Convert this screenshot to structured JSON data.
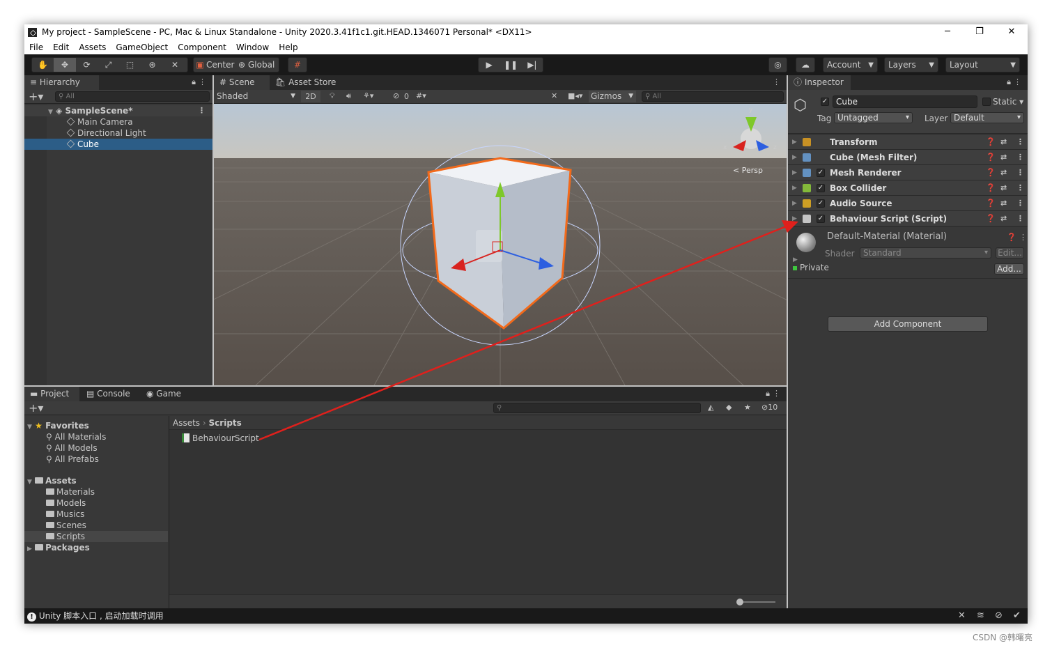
{
  "title_bar": {
    "title": "My project - SampleScene - PC, Mac & Linux Standalone - Unity 2020.3.41f1c1.git.HEAD.1346071 Personal* <DX11>",
    "minimize": "─",
    "restore": "❐",
    "close": "✕"
  },
  "menu": [
    "File",
    "Edit",
    "Assets",
    "GameObject",
    "Component",
    "Window",
    "Help"
  ],
  "toolbar": {
    "center": "Center",
    "global": "Global",
    "account": "Account",
    "layers": "Layers",
    "layout": "Layout"
  },
  "hierarchy": {
    "tab": "Hierarchy",
    "search_placeholder": "All",
    "scene": "SampleScene*",
    "items": [
      "Main Camera",
      "Directional Light",
      "Cube"
    ],
    "selected": "Cube"
  },
  "scene_view": {
    "tabs": [
      "Scene",
      "Asset Store"
    ],
    "shading": "Shaded",
    "mode_2d": "2D",
    "hidden_count": "0",
    "gizmos": "Gizmos",
    "search_placeholder": "All",
    "persp": "< Persp",
    "axes": {
      "x": "x",
      "y": "y",
      "z": "z"
    }
  },
  "bottom_tabs": [
    "Project",
    "Console",
    "Game"
  ],
  "project": {
    "favorites_label": "Favorites",
    "favorites": [
      "All Materials",
      "All Models",
      "All Prefabs"
    ],
    "assets_label": "Assets",
    "asset_folders": [
      "Materials",
      "Models",
      "Musics",
      "Scenes",
      "Scripts"
    ],
    "selected_folder": "Scripts",
    "packages_label": "Packages",
    "breadcrumb": [
      "Assets",
      "Scripts"
    ],
    "files": [
      "BehaviourScript"
    ],
    "hidden_count": "10"
  },
  "inspector": {
    "tab": "Inspector",
    "object_name": "Cube",
    "static_label": "Static",
    "tag_label": "Tag",
    "tag_value": "Untagged",
    "layer_label": "Layer",
    "layer_value": "Default",
    "components": [
      {
        "name": "Transform",
        "checkbox": false,
        "icon_color": "#e0a020"
      },
      {
        "name": "Cube (Mesh Filter)",
        "checkbox": false,
        "icon_color": "#6aa0d8"
      },
      {
        "name": "Mesh Renderer",
        "checkbox": true,
        "icon_color": "#6aa0d8"
      },
      {
        "name": "Box Collider",
        "checkbox": true,
        "icon_color": "#8fcf3a"
      },
      {
        "name": "Audio Source",
        "checkbox": true,
        "icon_color": "#e8b020"
      },
      {
        "name": "Behaviour Script (Script)",
        "checkbox": true,
        "icon_color": "#dddddd"
      }
    ],
    "material_name": "Default-Material (Material)",
    "shader_label": "Shader",
    "shader_value": "Standard",
    "edit_button": "Edit...",
    "private_label": "Private",
    "add_button": "Add...",
    "add_component": "Add Component"
  },
  "status_bar": {
    "message": "Unity 脚本入口 , 启动加载时调用"
  },
  "watermark": "CSDN @韩曙亮",
  "colors": {
    "selection": "#2c5d87",
    "cube_outline": "#f26a1b",
    "annotation_arrow": "#e0201c"
  }
}
